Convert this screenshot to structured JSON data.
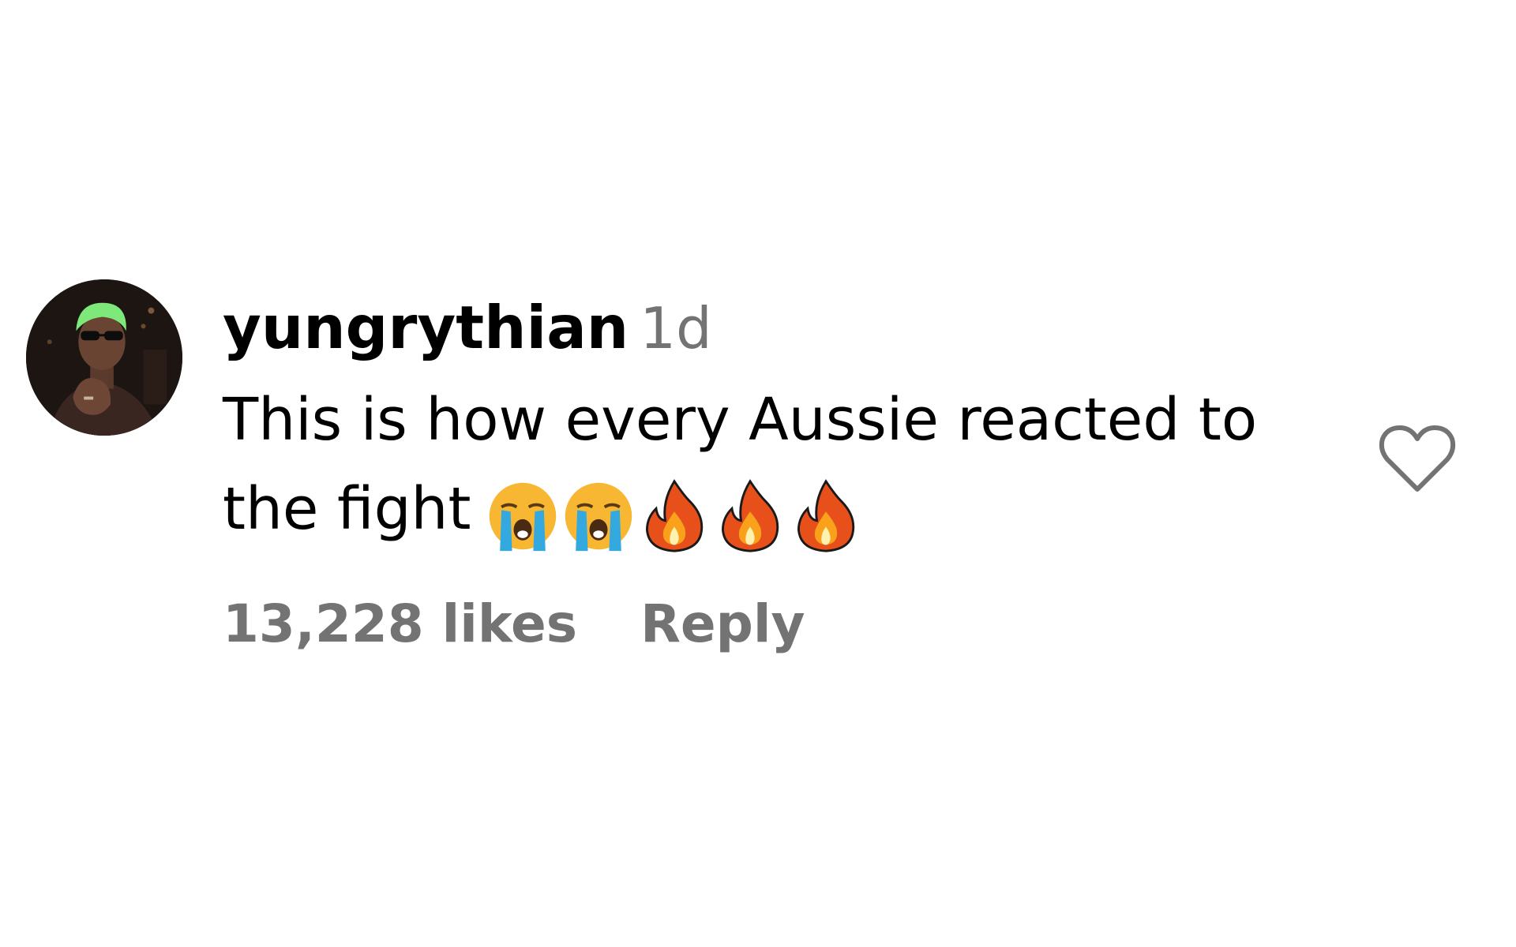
{
  "comment": {
    "username": "yungrythian",
    "timestamp": "1d",
    "text": "This is how every Aussie reacted to the fight",
    "emojis": [
      "loudly-crying-face-icon",
      "loudly-crying-face-icon",
      "fire-icon",
      "fire-icon",
      "fire-icon"
    ],
    "likes": "13,228 likes",
    "reply_label": "Reply"
  },
  "colors": {
    "text": "#000000",
    "muted": "#737373",
    "background": "#ffffff",
    "avatar_hair": "#7ee87a"
  }
}
